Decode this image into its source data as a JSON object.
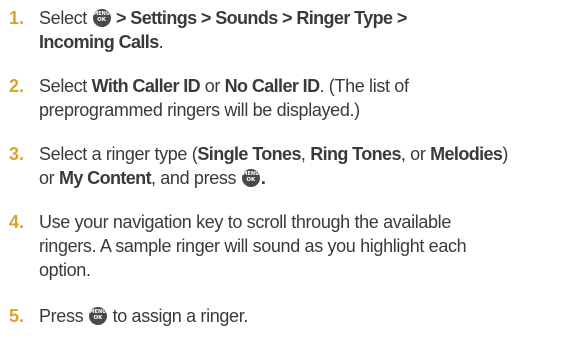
{
  "menu_key": {
    "top": "MENU",
    "bottom": "OK",
    "icon": "menu-ok-key-icon"
  },
  "steps": [
    {
      "number": "1.",
      "lines": [
        {
          "pre": "Select ",
          "post_bold": " > Settings > Sounds > Ringer Type >"
        },
        {
          "bold": "Incoming Calls",
          "tail": "."
        }
      ]
    },
    {
      "number": "2.",
      "lines": [
        {
          "pre": "Select ",
          "bold1": "With Caller ID",
          "mid": " or ",
          "bold2": "No Caller ID",
          "tail": ". (The list of"
        },
        {
          "text": "preprogrammed ringers will be displayed.)"
        }
      ]
    },
    {
      "number": "3.",
      "lines": [
        {
          "pre": "Select a ringer type (",
          "bold1": "Single Tones",
          "sep1": ", ",
          "bold2": "Ring Tones",
          "sep2": ", or ",
          "bold3": "Melodies",
          "tail": ")"
        },
        {
          "pre": "or ",
          "bold": "My Content",
          "mid": ", and press ",
          "tail": "."
        }
      ]
    },
    {
      "number": "4.",
      "lines": [
        {
          "text": " Use your navigation key to scroll through the available"
        },
        {
          "text": "ringers. A sample ringer will sound as you highlight each"
        },
        {
          "text": "option."
        }
      ]
    },
    {
      "number": "5.",
      "lines": [
        {
          "pre": "Press ",
          "tail": " to assign a ringer."
        }
      ]
    }
  ]
}
